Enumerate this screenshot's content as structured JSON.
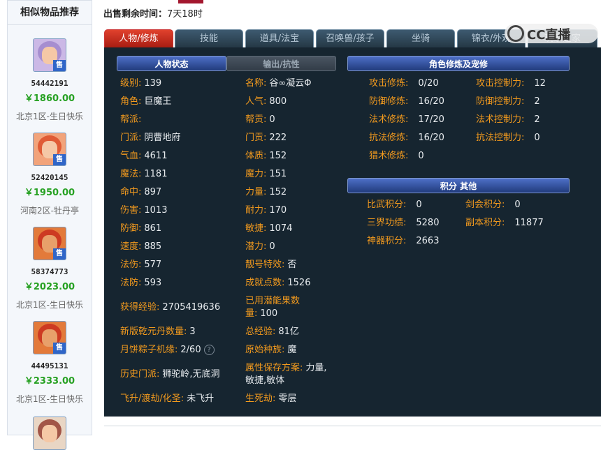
{
  "sidebar": {
    "title": "相似物品推荐",
    "items": [
      {
        "id": "54442191",
        "price": "￥1860.00",
        "server": "北京1区-生日快乐",
        "badge": "售",
        "hair": "#b79ad8"
      },
      {
        "id": "52420145",
        "price": "￥1950.00",
        "server": "河南2区-牡丹亭",
        "badge": "售",
        "hair": "#e04a28"
      },
      {
        "id": "58374773",
        "price": "￥2023.00",
        "server": "北京1区-生日快乐",
        "badge": "售",
        "hair": "#d83a1a"
      },
      {
        "id": "44495131",
        "price": "￥2333.00",
        "server": "北京1区-生日快乐",
        "badge": "售",
        "hair": "#d83a1a"
      }
    ]
  },
  "sale": {
    "label": "出售剩余时间：",
    "value": "7天18时"
  },
  "tabs": [
    "人物/修炼",
    "技能",
    "道具/法宝",
    "召唤兽/孩子",
    "坐骑",
    "锦衣/外观",
    "玩家之家"
  ],
  "watermark": {
    "text": "CC直播"
  },
  "sections": {
    "status": "人物状态",
    "output": "输出/抗性",
    "cultivation": "角色修炼及宠修",
    "points": "积分 其他"
  },
  "stats_left": [
    {
      "k": "级别:",
      "v": "139"
    },
    {
      "k": "角色:",
      "v": "巨魔王"
    },
    {
      "k": "帮派:",
      "v": ""
    },
    {
      "k": "门派:",
      "v": "阴曹地府"
    },
    {
      "k": "气血:",
      "v": "4611"
    },
    {
      "k": "魔法:",
      "v": "1181"
    },
    {
      "k": "命中:",
      "v": "897"
    },
    {
      "k": "伤害:",
      "v": "1013"
    },
    {
      "k": "防御:",
      "v": "861"
    },
    {
      "k": "速度:",
      "v": "885"
    },
    {
      "k": "法伤:",
      "v": "577"
    },
    {
      "k": "法防:",
      "v": "593"
    },
    {
      "k": "获得经验:",
      "v": "2705419636"
    },
    {
      "k": "新版乾元丹数量:",
      "v": "3"
    },
    {
      "k": "月饼粽子机缘:",
      "v": "2/60"
    },
    {
      "k": "历史门派:",
      "v": "狮驼岭,无底洞"
    },
    {
      "k": "飞升/渡劫/化圣:",
      "v": "未飞升"
    }
  ],
  "stats_right": [
    {
      "k": "名称:",
      "v": "谷∞凝云Φ"
    },
    {
      "k": "人气:",
      "v": "800"
    },
    {
      "k": "帮贡:",
      "v": "0"
    },
    {
      "k": "门贡:",
      "v": "222"
    },
    {
      "k": "体质:",
      "v": "152"
    },
    {
      "k": "魔力:",
      "v": "151"
    },
    {
      "k": "力量:",
      "v": "152"
    },
    {
      "k": "耐力:",
      "v": "170"
    },
    {
      "k": "敏捷:",
      "v": "1074"
    },
    {
      "k": "潜力:",
      "v": "0"
    },
    {
      "k": "靓号特效:",
      "v": "否"
    },
    {
      "k": "成就点数:",
      "v": "1526"
    },
    {
      "k": "已用潜能果数量:",
      "v": "100"
    },
    {
      "k": "总经验:",
      "v": "81亿"
    },
    {
      "k": "原始种族:",
      "v": "魔"
    },
    {
      "k": "属性保存方案:",
      "v": "力量,敏捷,敏体"
    },
    {
      "k": "生死劫:",
      "v": "零层"
    }
  ],
  "cultivation_left": [
    {
      "k": "攻击修炼:",
      "v": "0/20"
    },
    {
      "k": "防御修炼:",
      "v": "16/20"
    },
    {
      "k": "法术修炼:",
      "v": "17/20"
    },
    {
      "k": "抗法修炼:",
      "v": "16/20"
    },
    {
      "k": "猎术修炼:",
      "v": "0"
    }
  ],
  "cultivation_right": [
    {
      "k": "攻击控制力:",
      "v": "12"
    },
    {
      "k": "防御控制力:",
      "v": "2"
    },
    {
      "k": "法术控制力:",
      "v": "2"
    },
    {
      "k": "抗法控制力:",
      "v": "0"
    }
  ],
  "points": [
    {
      "k": "比武积分:",
      "v": "0"
    },
    {
      "k": "剑会积分:",
      "v": "0"
    },
    {
      "k": "三界功绩:",
      "v": "5280"
    },
    {
      "k": "副本积分:",
      "v": "11877"
    },
    {
      "k": "神器积分:",
      "v": "2663"
    }
  ]
}
